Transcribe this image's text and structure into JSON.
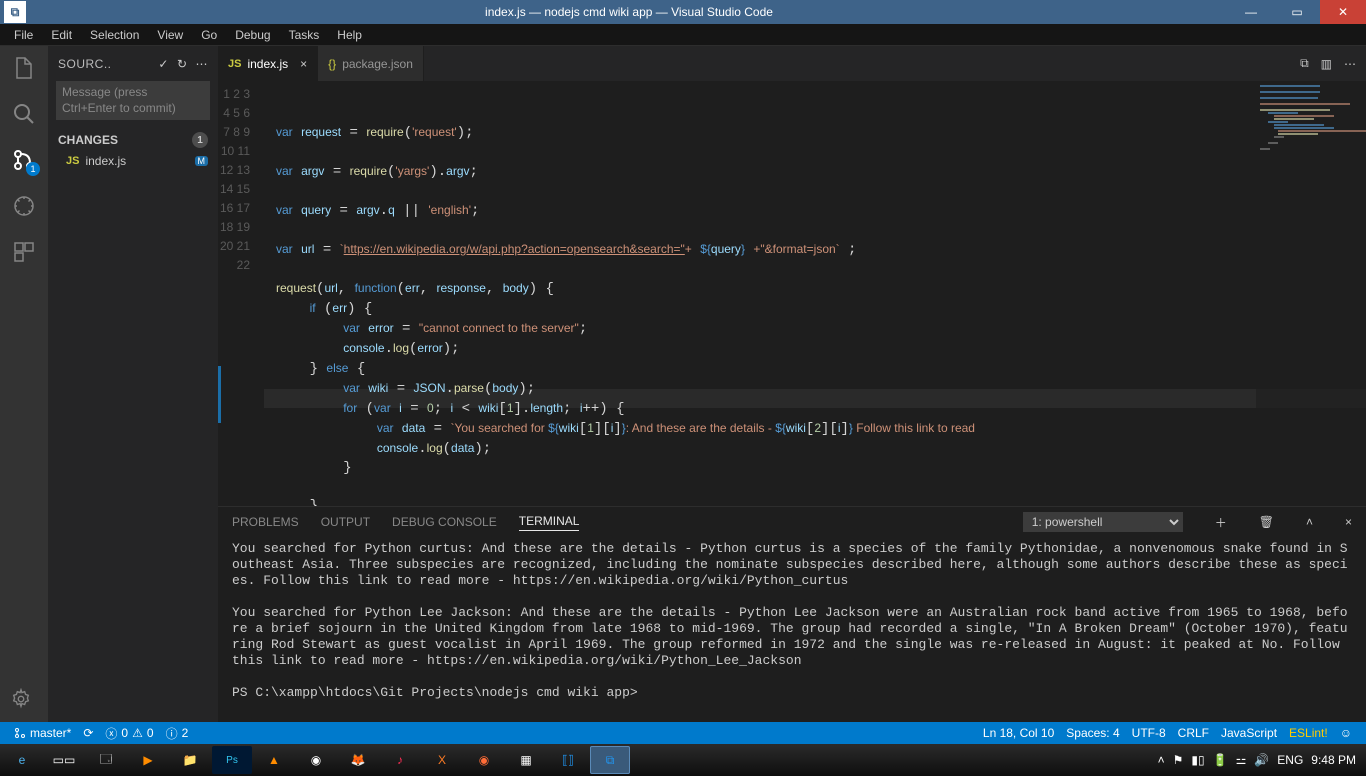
{
  "titlebar": {
    "title": "index.js — nodejs cmd wiki app — Visual Studio Code"
  },
  "menu": [
    "File",
    "Edit",
    "Selection",
    "View",
    "Go",
    "Debug",
    "Tasks",
    "Help"
  ],
  "activity": {
    "scm_badge": "1"
  },
  "sidebar": {
    "title": "SOURC..",
    "commit_placeholder": "Message (press Ctrl+Enter to commit)",
    "changes_label": "CHANGES",
    "changes_count": "1",
    "file": {
      "name": "index.js",
      "badge": "M"
    }
  },
  "tabs": {
    "active": "index.js",
    "other": "package.json"
  },
  "code": {
    "lines": [
      1,
      2,
      3,
      4,
      5,
      6,
      7,
      8,
      9,
      10,
      11,
      12,
      13,
      14,
      15,
      16,
      17,
      18,
      19,
      20,
      21,
      22
    ]
  },
  "panel": {
    "tabs": [
      "PROBLEMS",
      "OUTPUT",
      "DEBUG CONSOLE",
      "TERMINAL"
    ],
    "term_select": "1: powershell",
    "output": "You searched for Python curtus: And these are the details - Python curtus is a species of the family Pythonidae, a nonvenomous snake found in Southeast Asia. Three subspecies are recognized, including the nominate subspecies described here, although some authors describe these as species. Follow this link to read more - https://en.wikipedia.org/wiki/Python_curtus\n\nYou searched for Python Lee Jackson: And these are the details - Python Lee Jackson were an Australian rock band active from 1965 to 1968, before a brief sojourn in the United Kingdom from late 1968 to mid-1969. The group had recorded a single, \"In A Broken Dream\" (October 1970), featuring Rod Stewart as guest vocalist in April 1969. The group reformed in 1972 and the single was re-released in August: it peaked at No. Follow this link to read more - https://en.wikipedia.org/wiki/Python_Lee_Jackson\n\nPS C:\\xampp\\htdocs\\Git Projects\\nodejs cmd wiki app> "
  },
  "status": {
    "branch": "master*",
    "sync": "",
    "errors": "0",
    "warnings": "0",
    "info": "2",
    "ln": "Ln 18, Col 10",
    "spaces": "Spaces: 4",
    "enc": "UTF-8",
    "eol": "CRLF",
    "lang": "JavaScript",
    "eslint": "ESLint!",
    "smile": "☺"
  },
  "tray": {
    "lang": "ENG",
    "time": "9:48 PM"
  }
}
